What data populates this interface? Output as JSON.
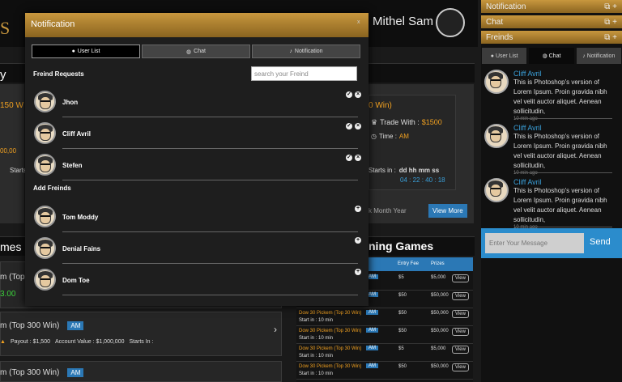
{
  "background": {
    "username": "Mithel Sam",
    "left_section_title": "y",
    "left_section_title2": "mes",
    "upcoming_title": "ning Games",
    "win_text": "150 W",
    "win_text2": "0 Win)",
    "trade_label": "Trade With :",
    "trade_value": "$1500",
    "time_label": "Time :",
    "time_value": "AM",
    "starts_label": "Starts in :",
    "countdown_labels": "dd hh mm ss",
    "countdown_values": "04 : 22 : 40 : 18",
    "filter_text": "k  Month  Year",
    "view_more": "View More",
    "left_value_partial": "00,00",
    "start_partial": "Starts",
    "game_row1": "m (Top",
    "game_row1_value": "3.00",
    "game_row2": "m (Top 300 Win)",
    "game_row2_tag": "AM",
    "payout": "Payout : $1,500",
    "account_value": "Account Value : $1,000,000",
    "starts_in": "Starts In :",
    "game_row3": "m (Top 300 Win)",
    "game_row3_tag": "AM",
    "table_headers": [
      "Entry Fee",
      "Prizes"
    ],
    "table_rows": [
      {
        "name": "",
        "tag": "AM",
        "fee": "$5",
        "prize": "$5,000",
        "start": "",
        "view": "View"
      },
      {
        "name": "",
        "tag": "AM",
        "fee": "$50",
        "prize": "$50,000",
        "start": "Start in : 10 min",
        "view": "View"
      },
      {
        "name": "Dow 30 Pickem (Top 30 Win)",
        "tag": "AM",
        "fee": "$50",
        "prize": "$50,000",
        "start": "Start in : 10 min",
        "view": "View"
      },
      {
        "name": "Dow 30 Pickem (Top 30 Win)",
        "tag": "AM",
        "fee": "$50",
        "prize": "$50,000",
        "start": "Start in : 10 min",
        "view": "View"
      },
      {
        "name": "Dow 30 Pickem (Top 30 Win)",
        "tag": "AM",
        "fee": "$5",
        "prize": "$5,000",
        "start": "Start in : 10 min",
        "view": "View"
      },
      {
        "name": "Dow 30 Pickem (Top 30 Win)",
        "tag": "AM",
        "fee": "$50",
        "prize": "$50,000",
        "start": "Start in : 10 min",
        "view": "View"
      }
    ]
  },
  "right_panel": {
    "sections": [
      "Notification",
      "Chat",
      "Freinds"
    ],
    "tabs": [
      "User List",
      "Chat",
      "Notification"
    ],
    "messages": [
      {
        "name": "Cliff Avril",
        "text": "This is Photoshop's version of Lorem Ipsum. Proin gravida nibh vel velit auctor aliquet. Aenean sollicitudin,",
        "time": "10 min ago"
      },
      {
        "name": "Cliff Avril",
        "text": "This is Photoshop's version of Lorem Ipsum. Proin gravida nibh vel velit auctor aliquet. Aenean sollicitudin,",
        "time": "10 min ago"
      },
      {
        "name": "Cliff Avril",
        "text": "This is Photoshop's version of Lorem Ipsum. Proin gravida nibh vel velit auctor aliquet. Aenean sollicitudin,",
        "time": "10 min ago"
      }
    ],
    "message_placeholder": "Enter Your Message",
    "send_label": "Send"
  },
  "modal": {
    "title": "Notification",
    "close": "x",
    "tabs": [
      "User List",
      "Chat",
      "Notification"
    ],
    "friend_requests_title": "Freind Requests",
    "search_placeholder": "search your Freind",
    "requests": [
      "Jhon",
      "Cliff Avril",
      "Stefen"
    ],
    "add_friends_title": "Add Freinds",
    "suggestions": [
      "Tom Moddy",
      "Denial Fains",
      "Dom Toe"
    ]
  },
  "colors": {
    "accent_gold": "#c8973e",
    "link_blue": "#3a9fd8",
    "send_blue": "#2b8ccc"
  }
}
